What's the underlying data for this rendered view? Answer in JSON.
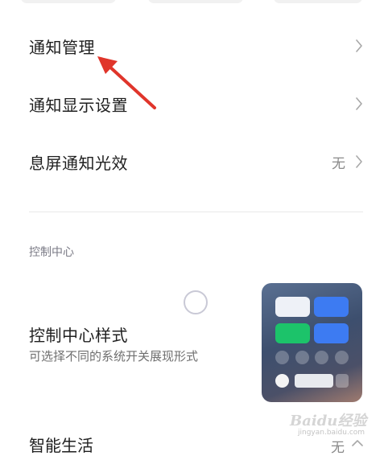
{
  "settings": {
    "items": [
      {
        "label": "通知管理",
        "value": ""
      },
      {
        "label": "通知显示设置",
        "value": ""
      },
      {
        "label": "息屏通知光效",
        "value": "无"
      }
    ]
  },
  "control_center": {
    "section_title": "控制中心",
    "title": "控制中心样式",
    "subtitle": "可选择不同的系统开关展现形式"
  },
  "bottom_item": {
    "label": "智能生活",
    "value": "无"
  },
  "watermark": {
    "brand": "Baidu经验",
    "url": "jingyan.baidu.com"
  },
  "colors": {
    "arrow": "#e0352b",
    "accent_blue": "#3d7bf2",
    "accent_green": "#1cc36a"
  }
}
